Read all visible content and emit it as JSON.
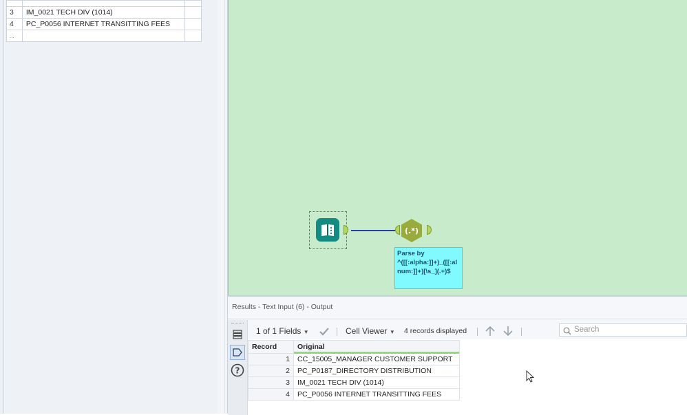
{
  "config_grid": {
    "rows": [
      {
        "index": "3",
        "value": "IM_0021 TECH DIV (1014)"
      },
      {
        "index": "4",
        "value": "PC_P0056 INTERNET TRANSITTING FEES"
      }
    ],
    "new_row_marker": "..."
  },
  "canvas": {
    "background": "#c8ebcb",
    "tools": [
      {
        "name": "Text Input",
        "icon": "text-input-book-icon",
        "color": "#138a82"
      },
      {
        "name": "RegEx",
        "icon": "regex-hexagon-icon",
        "color": "#9aab3d",
        "glyph": "(.*)"
      }
    ],
    "annotation": {
      "title": "Parse by",
      "expression": "^([[:alpha:]]+)_([[:alnum:]]+)[\\s_](.+)$"
    }
  },
  "results": {
    "title": "Results - Text Input (6) - Output",
    "toolbar": {
      "fields": "1 of 1 Fields",
      "viewer": "Cell Viewer",
      "records": "4 records displayed",
      "search_placeholder": "Search"
    },
    "columns": [
      "Record",
      "Original"
    ],
    "rows": [
      {
        "record": "1",
        "original": "CC_15005_MANAGER CUSTOMER SUPPORT"
      },
      {
        "record": "2",
        "original": "PC_P0187_DIRECTORY DISTRIBUTION"
      },
      {
        "record": "3",
        "original": "IM_0021 TECH DIV (1014)"
      },
      {
        "record": "4",
        "original": "PC_P0056 INTERNET TRANSITTING FEES"
      }
    ]
  }
}
